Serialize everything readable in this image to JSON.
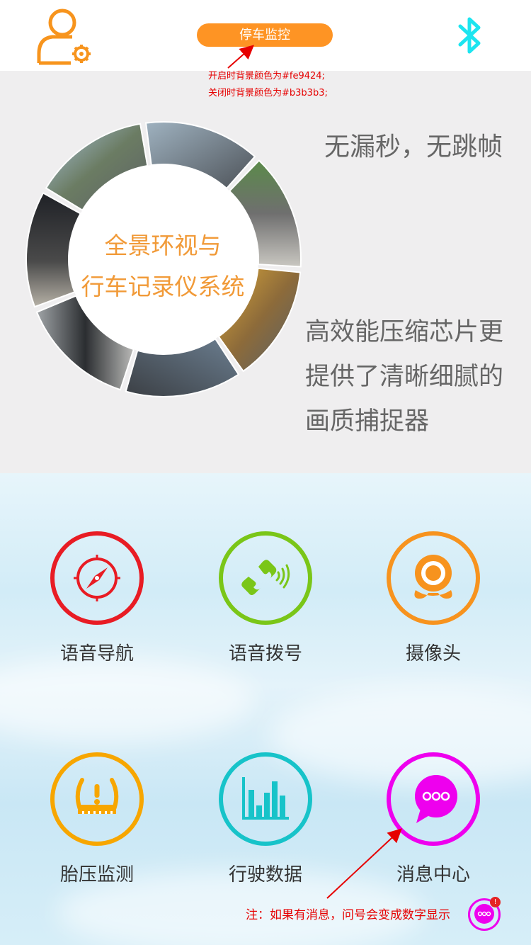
{
  "header": {
    "park_monitor_label": "停车监控",
    "park_monitor_color_on": "#fe9424",
    "park_monitor_color_off": "#b3b3b3",
    "user_icon": "user-settings-icon",
    "bluetooth_icon": "bluetooth-icon",
    "icon_orange": "#f7941d",
    "icon_cyan": "#1ce5f0"
  },
  "annotations": {
    "on_note": "开启时背景颜色为#fe9424;",
    "off_note": "关闭时背景颜色为#b3b3b3;",
    "message_note": "注：如果有消息，问号会变成数字显示"
  },
  "hero": {
    "ring_title_line1": "全景环视与",
    "ring_title_line2": "行车记录仪系统",
    "slogan1": "无漏秒，无跳帧",
    "slogan2_line1": "高效能压缩芯片更",
    "slogan2_line2": "提供了清晰细腻的",
    "slogan2_line3": "画质捕捉器",
    "title_color": "#f19a38"
  },
  "menu": {
    "items": [
      {
        "label": "语音导航",
        "icon": "compass-icon",
        "color": "#e81c24"
      },
      {
        "label": "语音拨号",
        "icon": "phone-icon",
        "color": "#7ac618"
      },
      {
        "label": "摄像头",
        "icon": "webcam-icon",
        "color": "#f7931e"
      },
      {
        "label": "胎压监测",
        "icon": "tire-pressure-icon",
        "color": "#f7a600"
      },
      {
        "label": "行驶数据",
        "icon": "bar-chart-icon",
        "color": "#17c3c9"
      },
      {
        "label": "消息中心",
        "icon": "chat-bubble-icon",
        "color": "#ee00ee"
      }
    ]
  },
  "message_badge": "!"
}
